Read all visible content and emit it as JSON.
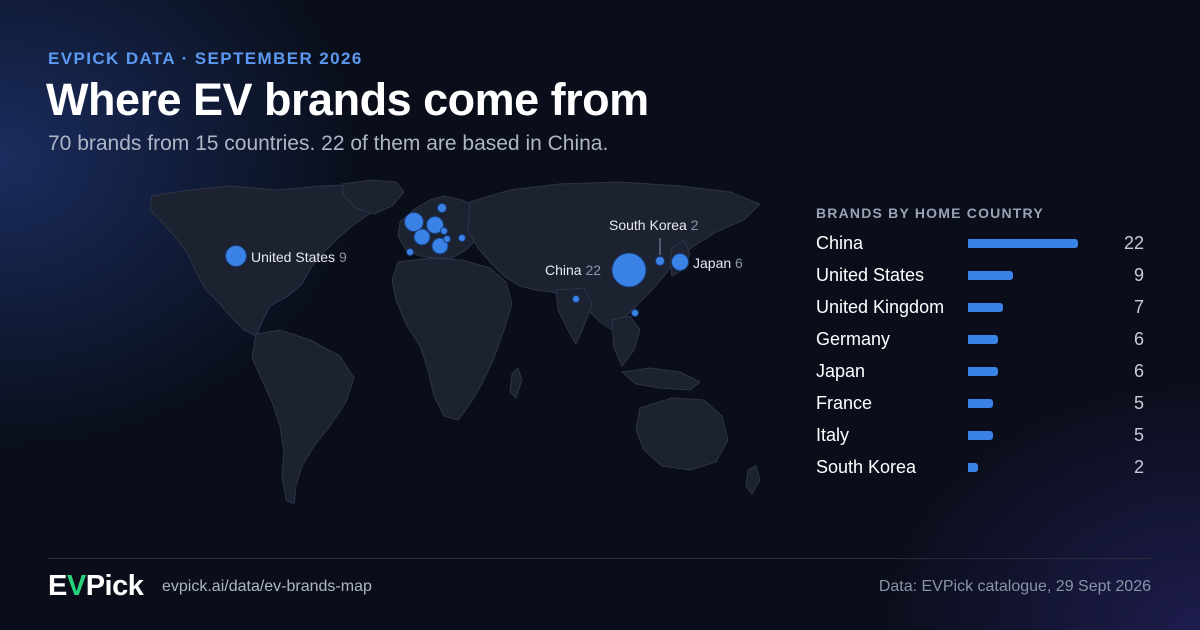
{
  "header": {
    "kicker": "EVPICK DATA · SEPTEMBER 2026",
    "title": "Where EV brands come from",
    "subtitle": "70 brands from 15 countries. 22 of them are based in China."
  },
  "map": {
    "labels": [
      {
        "name": "United States",
        "count": "9"
      },
      {
        "name": "China",
        "count": "22"
      },
      {
        "name": "South Korea",
        "count": "2"
      },
      {
        "name": "Japan",
        "count": "6"
      }
    ]
  },
  "panel": {
    "title": "BRANDS BY HOME COUNTRY",
    "accent": "#3a82e6",
    "rows": [
      {
        "name": "China",
        "count": 22
      },
      {
        "name": "United States",
        "count": 9
      },
      {
        "name": "United Kingdom",
        "count": 7
      },
      {
        "name": "Germany",
        "count": 6
      },
      {
        "name": "Japan",
        "count": 6
      },
      {
        "name": "France",
        "count": 5
      },
      {
        "name": "Italy",
        "count": 5
      },
      {
        "name": "South Korea",
        "count": 2
      }
    ]
  },
  "footer": {
    "logo_left": "E",
    "logo_v": "V",
    "logo_right": "Pick",
    "url": "evpick.ai/data/ev-brands-map",
    "source": "Data: EVPick catalogue, 29 Sept 2026"
  }
}
